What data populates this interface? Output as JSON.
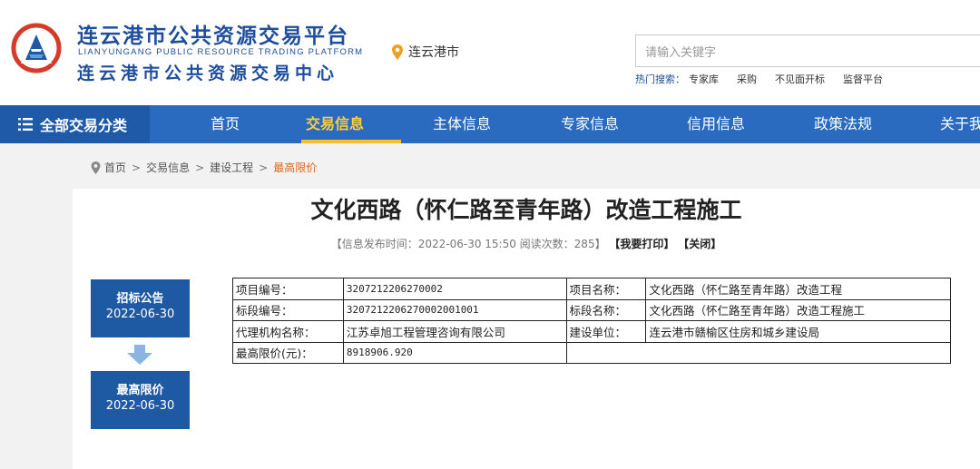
{
  "header": {
    "title_main": "连云港市公共资源交易平台",
    "title_en": "LIANYUNGANG PUBLIC RESOURCE TRADING PLATFORM",
    "title_sub": "连云港市公共资源交易中心",
    "city": "连云港市",
    "search_placeholder": "请输入关键字",
    "hot_label": "热门搜索：",
    "hot_items": [
      "专家库",
      "采购",
      "不见面开标",
      "监督平台"
    ]
  },
  "nav": {
    "all_label": "全部交易分类",
    "items": [
      "首页",
      "交易信息",
      "主体信息",
      "专家信息",
      "信用信息",
      "政策法规",
      "关于我"
    ],
    "active": "交易信息"
  },
  "breadcrumb": [
    "首页",
    "交易信息",
    "建设工程",
    "最高限价"
  ],
  "article": {
    "title": "文化西路（怀仁路至青年路）改造工程施工",
    "meta_prefix": "【信息发布时间：2022-06-30 15:50  阅读次数：285】",
    "print_label": "【我要打印】",
    "close_label": "【关闭】"
  },
  "timeline": [
    {
      "title": "招标公告",
      "date": "2022-06-30"
    },
    {
      "title": "最高限价",
      "date": "2022-06-30"
    }
  ],
  "table": {
    "project_no_label": "项目编号：",
    "project_no": "3207212206270002",
    "project_name_label": "项目名称：",
    "project_name": "文化西路（怀仁路至青年路）改造工程",
    "section_no_label": "标段编号：",
    "section_no": "3207212206270002001001",
    "section_name_label": "标段名称：",
    "section_name": "文化西路（怀仁路至青年路）改造工程施工",
    "agency_label": "代理机构名称：",
    "agency": "江苏卓旭工程管理咨询有限公司",
    "builder_label": "建设单位：",
    "builder": "连云港市赣榆区住房和城乡建设局",
    "max_price_label": "最高限价(元)：",
    "max_price": "8918906.920"
  },
  "colors": {
    "brand_blue": "#1e4e9c",
    "nav_blue": "#2a6bc0",
    "active_yellow": "#ffcf3a",
    "breadcrumb_current": "#e2621b",
    "timeline_blue": "#1e5aa3"
  }
}
